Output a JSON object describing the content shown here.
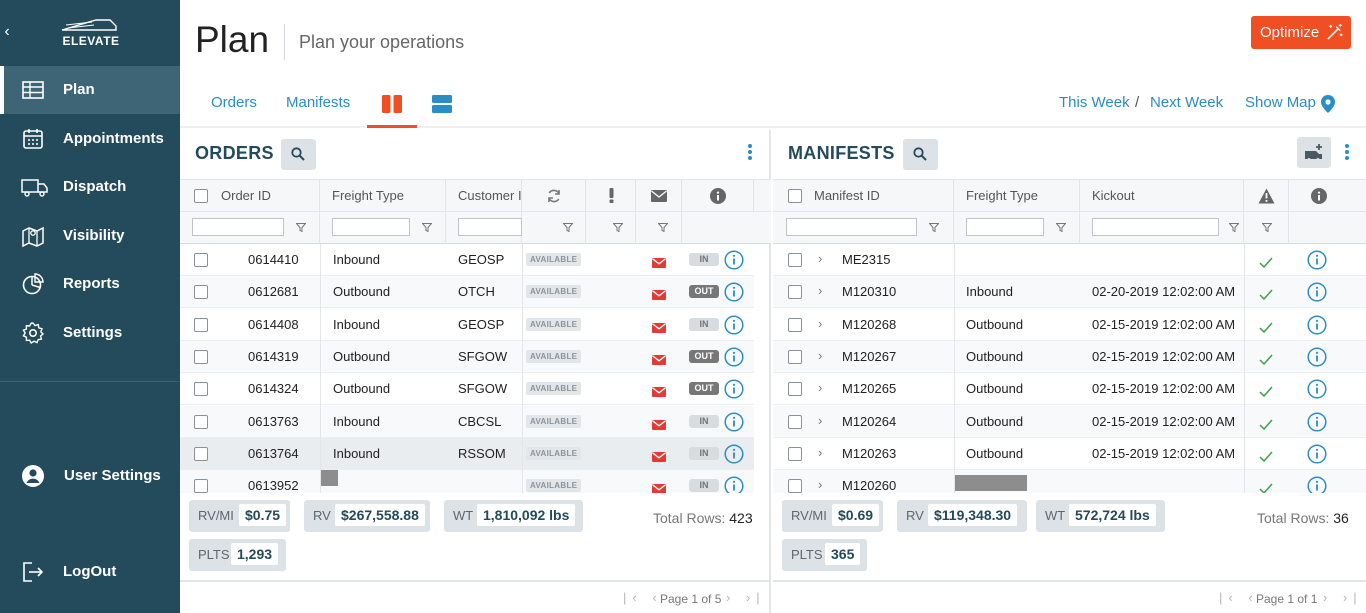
{
  "sidebar": {
    "logo_text": "ELEVATE",
    "items": [
      {
        "label": "Plan",
        "icon": "table-icon"
      },
      {
        "label": "Appointments",
        "icon": "calendar-icon"
      },
      {
        "label": "Dispatch",
        "icon": "truck-icon"
      },
      {
        "label": "Visibility",
        "icon": "map-icon"
      },
      {
        "label": "Reports",
        "icon": "pie-chart-icon"
      },
      {
        "label": "Settings",
        "icon": "gear-icon"
      }
    ],
    "user_settings": "User Settings",
    "logout": "LogOut"
  },
  "header": {
    "title": "Plan",
    "subtitle": "Plan your operations",
    "optimize": "Optimize",
    "tabs": [
      "Orders",
      "Manifests"
    ],
    "this_week": "This Week",
    "week_sep": "/",
    "next_week": "Next Week",
    "show_map": "Show Map"
  },
  "orders": {
    "title": "ORDERS",
    "columns": {
      "order_id": "Order ID",
      "freight_type": "Freight Type",
      "customer_id": "Customer ID"
    },
    "rows": [
      {
        "id": "0614410",
        "freight": "Inbound",
        "customer": "GEOSP",
        "status": "AVAILABLE",
        "dir": "IN"
      },
      {
        "id": "0612681",
        "freight": "Outbound",
        "customer": "OTCH",
        "status": "AVAILABLE",
        "dir": "OUT"
      },
      {
        "id": "0614408",
        "freight": "Inbound",
        "customer": "GEOSP",
        "status": "AVAILABLE",
        "dir": "IN"
      },
      {
        "id": "0614319",
        "freight": "Outbound",
        "customer": "SFGOW",
        "status": "AVAILABLE",
        "dir": "OUT"
      },
      {
        "id": "0614324",
        "freight": "Outbound",
        "customer": "SFGOW",
        "status": "AVAILABLE",
        "dir": "OUT"
      },
      {
        "id": "0613763",
        "freight": "Inbound",
        "customer": "CBCSL",
        "status": "AVAILABLE",
        "dir": "IN"
      },
      {
        "id": "0613764",
        "freight": "Inbound",
        "customer": "RSSOM",
        "status": "AVAILABLE",
        "dir": "IN"
      },
      {
        "id": "0613952",
        "freight": "",
        "customer": "",
        "status": "AVAILABLE",
        "dir": "IN"
      }
    ],
    "stats": {
      "rvmi_label": "RV/MI",
      "rvmi": "$0.75",
      "rv_label": "RV",
      "rv": "$267,558.88",
      "wt_label": "WT",
      "wt": "1,810,092 lbs",
      "plts_label": "PLTS",
      "plts": "1,293"
    },
    "total_rows_label": "Total Rows:",
    "total_rows": "423",
    "pager": "Page 1 of 5"
  },
  "manifests": {
    "title": "MANIFESTS",
    "columns": {
      "manifest_id": "Manifest ID",
      "freight_type": "Freight Type",
      "kickout": "Kickout"
    },
    "rows": [
      {
        "id": "ME2315",
        "freight": "",
        "kickout": ""
      },
      {
        "id": "M120310",
        "freight": "Inbound",
        "kickout": "02-20-2019 12:02:00 AM"
      },
      {
        "id": "M120268",
        "freight": "Outbound",
        "kickout": "02-15-2019 12:02:00 AM"
      },
      {
        "id": "M120267",
        "freight": "Outbound",
        "kickout": "02-15-2019 12:02:00 AM"
      },
      {
        "id": "M120265",
        "freight": "Outbound",
        "kickout": "02-15-2019 12:02:00 AM"
      },
      {
        "id": "M120264",
        "freight": "Outbound",
        "kickout": "02-15-2019 12:02:00 AM"
      },
      {
        "id": "M120263",
        "freight": "Outbound",
        "kickout": "02-15-2019 12:02:00 AM"
      },
      {
        "id": "M120260",
        "freight": "",
        "kickout": ""
      }
    ],
    "stats": {
      "rvmi_label": "RV/MI",
      "rvmi": "$0.69",
      "rv_label": "RV",
      "rv": "$119,348.30",
      "wt_label": "WT",
      "wt": "572,724 lbs",
      "plts_label": "PLTS",
      "plts": "365"
    },
    "total_rows_label": "Total Rows:",
    "total_rows": "36",
    "pager": "Page 1 of 1"
  },
  "colors": {
    "sidebar": "#234b5c",
    "accent": "#f04e23",
    "link": "#2b8dc6",
    "check": "#3ca24b"
  }
}
